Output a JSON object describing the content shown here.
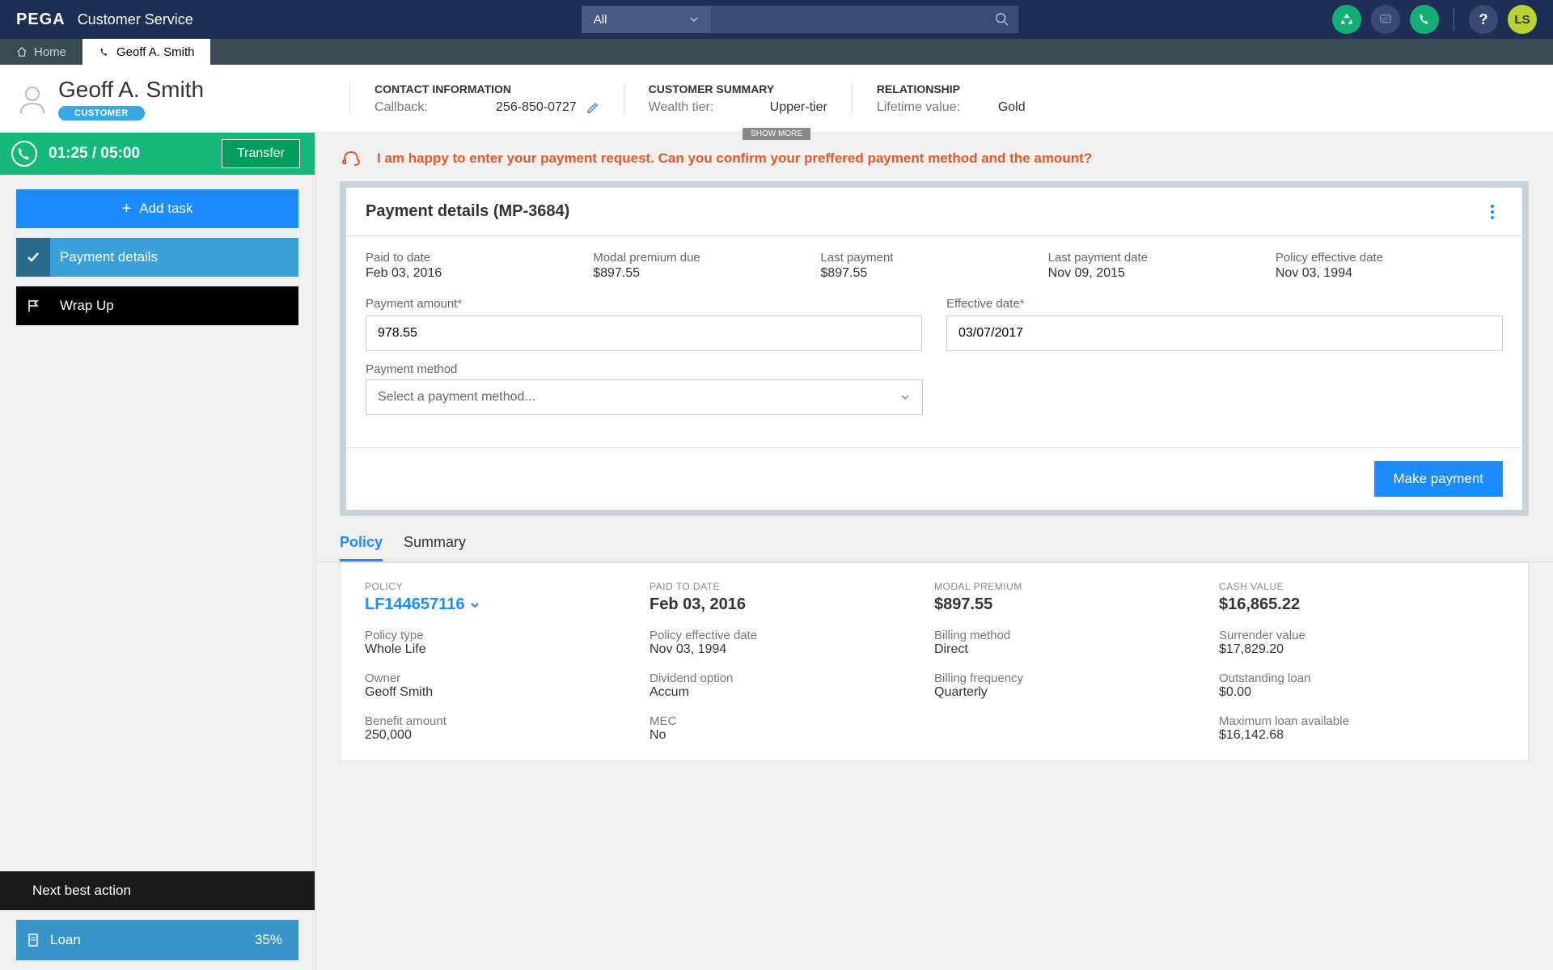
{
  "header": {
    "logo": "PEGA",
    "app_name": "Customer Service",
    "search_filter": "All",
    "user_initials": "LS"
  },
  "tabs": {
    "home": "Home",
    "customer": "Geoff A. Smith"
  },
  "customer": {
    "name": "Geoff A. Smith",
    "badge": "CUSTOMER",
    "contact": {
      "title": "CONTACT INFORMATION",
      "callback_label": "Callback:",
      "callback_value": "256-850-0727"
    },
    "summary": {
      "title": "CUSTOMER SUMMARY",
      "tier_label": "Wealth tier:",
      "tier_value": "Upper-tier"
    },
    "relationship": {
      "title": "RELATIONSHIP",
      "ltv_label": "Lifetime value:",
      "ltv_value": "Gold"
    },
    "show_more": "SHOW MORE"
  },
  "call": {
    "timer": "01:25 / 05:00",
    "transfer": "Transfer"
  },
  "sidebar": {
    "add_task": "Add task",
    "payment_details": "Payment details",
    "wrap_up": "Wrap Up"
  },
  "nba": {
    "header": "Next best action",
    "item_label": "Loan",
    "item_pct": "35%"
  },
  "prompt": "I am happy to enter your payment request. Can you confirm your preffered payment method and the amount?",
  "payment_card": {
    "title": "Payment details (MP-3684)",
    "paid_to_date_label": "Paid to date",
    "paid_to_date": "Feb 03, 2016",
    "modal_premium_label": "Modal premium due",
    "modal_premium": "$897.55",
    "last_payment_label": "Last payment",
    "last_payment": "$897.55",
    "last_payment_date_label": "Last payment date",
    "last_payment_date": "Nov 09, 2015",
    "policy_eff_label": "Policy effective date",
    "policy_eff": "Nov 03, 1994",
    "payment_amount_label": "Payment amount",
    "payment_amount": "978.55",
    "effective_date_label": "Effective date",
    "effective_date": "03/07/2017",
    "payment_method_label": "Payment method",
    "payment_method_placeholder": "Select a payment method...",
    "make_payment": "Make payment"
  },
  "sub_tabs": {
    "policy": "Policy",
    "summary": "Summary"
  },
  "policy": {
    "policy_label": "POLICY",
    "policy_num": "LF144657116",
    "paid_to_date_label": "PAID TO DATE",
    "paid_to_date": "Feb 03, 2016",
    "modal_prem_label": "MODAL PREMIUM",
    "modal_prem": "$897.55",
    "cash_value_label": "CASH VALUE",
    "cash_value": "$16,865.22",
    "policy_type_label": "Policy type",
    "policy_type": "Whole Life",
    "peff_label": "Policy effective date",
    "peff": "Nov 03, 1994",
    "billing_method_label": "Billing method",
    "billing_method": "Direct",
    "surrender_label": "Surrender value",
    "surrender": "$17,829.20",
    "owner_label": "Owner",
    "owner": "Geoff Smith",
    "dividend_label": "Dividend option",
    "dividend": "Accum",
    "billing_freq_label": "Billing frequency",
    "billing_freq": "Quarterly",
    "loan_out_label": "Outstanding loan",
    "loan_out": "$0.00",
    "benefit_label": "Benefit amount",
    "benefit": "250,000",
    "mec_label": "MEC",
    "mec": "No",
    "max_loan_label": "Maximum loan available",
    "max_loan": "$16,142.68"
  }
}
